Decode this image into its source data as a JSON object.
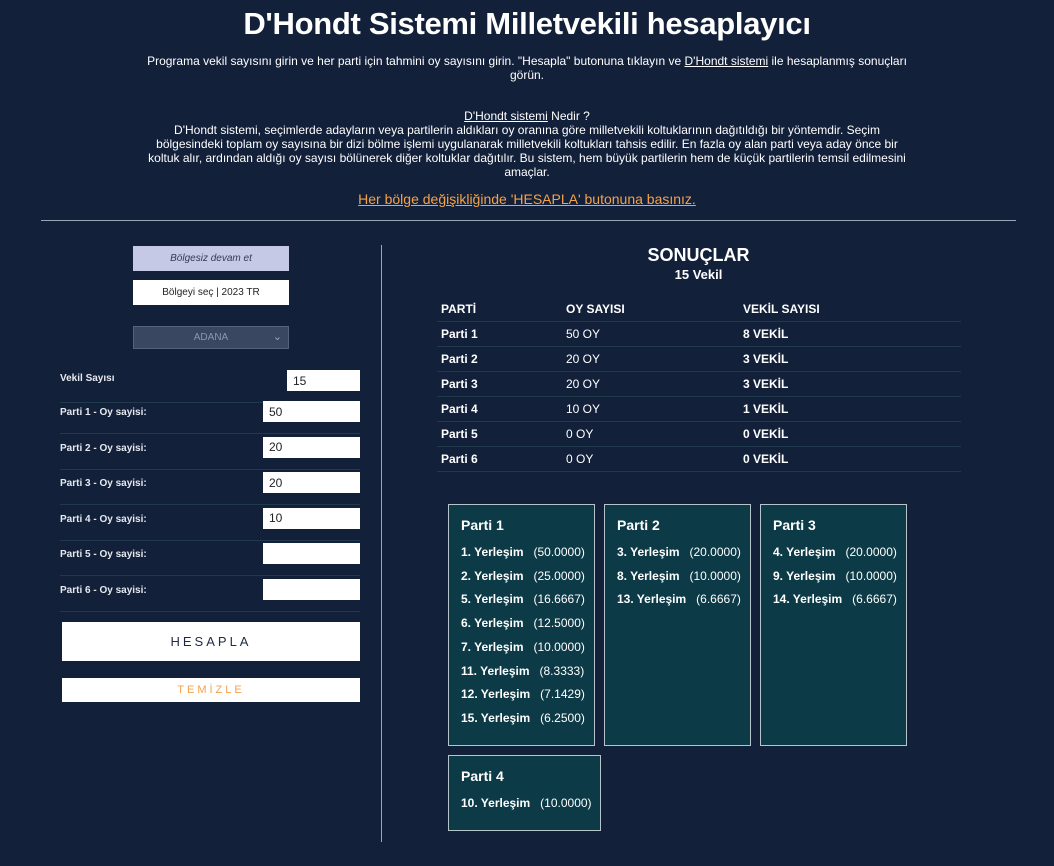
{
  "header": {
    "title": "D'Hondt Sistemi Milletvekili hesaplayıcı",
    "intro_before": "Programa vekil sayısını girin ve her parti için tahmini oy sayısını girin. \"Hesapla\" butonuna tıklayın ve ",
    "intro_link": "D'Hondt sistemi",
    "intro_after": " ile hesaplanmış sonuçları görün.",
    "about_link": "D'Hondt sistemi",
    "about_heading_rest": " Nedir ?",
    "about_text": "D'Hondt sistemi, seçimlerde adayların veya partilerin aldıkları oy oranına göre milletvekili koltuklarının dağıtıldığı bir yöntemdir. Seçim bölgesindeki toplam oy sayısına bir dizi bölme işlemi uygulanarak milletvekili koltukları tahsis edilir. En fazla oy alan parti veya aday önce bir koltuk alır, ardından aldığı oy sayısı bölünerek diğer koltuklar dağıtılır. Bu sistem, hem büyük partilerin hem de küçük partilerin temsil edilmesini amaçlar.",
    "warning": "Her bölge değişikliğinde 'HESAPLA' butonuna basınız."
  },
  "left": {
    "bolgesiz_label": "Bölgesiz devam et",
    "bolge_label": "Bölgeyi seç | 2023 TR",
    "il_select": "ADANA",
    "vekil_label": "Vekil Sayısı",
    "vekil_value": "15",
    "parties": [
      {
        "label": "Parti 1 - Oy sayisi:",
        "value": "50"
      },
      {
        "label": "Parti 2 - Oy sayisi:",
        "value": "20"
      },
      {
        "label": "Parti 3 - Oy sayisi:",
        "value": "20"
      },
      {
        "label": "Parti 4 - Oy sayisi:",
        "value": "10"
      },
      {
        "label": "Parti 5 - Oy sayisi:",
        "value": ""
      },
      {
        "label": "Parti 6 - Oy sayisi:",
        "value": ""
      }
    ],
    "hesapla_label": "HESAPLA",
    "temizle_label": "TEMİZLE"
  },
  "results": {
    "title": "SONUÇLAR",
    "subtitle": "15 Vekil",
    "headers": [
      "PARTİ",
      "OY SAYISI",
      "VEKİL SAYISI"
    ],
    "rows": [
      [
        "Parti 1",
        "50 OY",
        "8 VEKİL"
      ],
      [
        "Parti 2",
        "20 OY",
        "3 VEKİL"
      ],
      [
        "Parti 3",
        "20 OY",
        "3 VEKİL"
      ],
      [
        "Parti 4",
        "10 OY",
        "1 VEKİL"
      ],
      [
        "Parti 5",
        "0 OY",
        "0 VEKİL"
      ],
      [
        "Parti 6",
        "0 OY",
        "0 VEKİL"
      ]
    ],
    "cards": [
      {
        "title": "Parti 1",
        "items": [
          {
            "pos": "1. Yerleşim",
            "val": "(50.0000)"
          },
          {
            "pos": "2. Yerleşim",
            "val": "(25.0000)"
          },
          {
            "pos": "5. Yerleşim",
            "val": "(16.6667)"
          },
          {
            "pos": "6. Yerleşim",
            "val": "(12.5000)"
          },
          {
            "pos": "7. Yerleşim",
            "val": "(10.0000)"
          },
          {
            "pos": "11. Yerleşim",
            "val": "(8.3333)"
          },
          {
            "pos": "12. Yerleşim",
            "val": "(7.1429)"
          },
          {
            "pos": "15. Yerleşim",
            "val": "(6.2500)"
          }
        ]
      },
      {
        "title": "Parti 2",
        "items": [
          {
            "pos": "3. Yerleşim",
            "val": "(20.0000)"
          },
          {
            "pos": "8. Yerleşim",
            "val": "(10.0000)"
          },
          {
            "pos": "13. Yerleşim",
            "val": "(6.6667)"
          }
        ]
      },
      {
        "title": "Parti 3",
        "items": [
          {
            "pos": "4. Yerleşim",
            "val": "(20.0000)"
          },
          {
            "pos": "9. Yerleşim",
            "val": "(10.0000)"
          },
          {
            "pos": "14. Yerleşim",
            "val": "(6.6667)"
          }
        ]
      },
      {
        "title": "Parti 4",
        "items": [
          {
            "pos": "10. Yerleşim",
            "val": "(10.0000)"
          }
        ]
      }
    ]
  }
}
